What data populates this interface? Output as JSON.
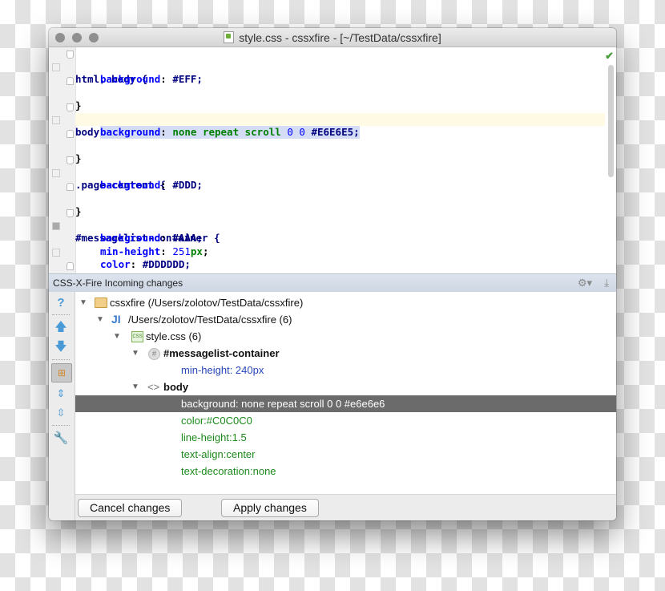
{
  "window": {
    "title": "style.css - cssxfire - [~/TestData/cssxfire]",
    "title_icon": "css-file-icon"
  },
  "editor": {
    "lines": [
      {
        "selector": "html, body {"
      },
      {
        "property": "background",
        "value": "#EFF;"
      },
      {
        "brace": "}"
      },
      {
        "selector": "body {"
      },
      {
        "property": "background",
        "keywords": "none repeat scroll",
        "numbers": "0 0",
        "value": "#E6E6E5;"
      },
      {
        "brace": "}"
      },
      {
        "selector": ".page-content {"
      },
      {
        "property": "background",
        "value": "#DDD;"
      },
      {
        "brace": "}"
      },
      {
        "selector": "#messagelist-container {"
      },
      {
        "property": "background",
        "value": "#AAA;"
      },
      {
        "property": "min-height",
        "number": "251",
        "unit": "px",
        "end": ";"
      },
      {
        "property": "color",
        "value": "#DDDDDD;"
      },
      {
        "brace": "}"
      }
    ],
    "status_icon": "inspection-ok-icon"
  },
  "tool_window": {
    "title": "CSS-X-Fire Incoming changes",
    "actions": [
      "gear-icon",
      "hide-icon"
    ],
    "side_toolbar": [
      "help-icon",
      "previous-icon",
      "next-icon",
      "group-by-file-icon",
      "expand-all-icon",
      "collapse-all-icon",
      "settings-icon"
    ],
    "tree": [
      {
        "label": "cssxfire (/Users/zolotov/TestData/cssxfire)",
        "icon": "folder-icon"
      },
      {
        "label": "/Users/zolotov/TestData/cssxfire (6)",
        "icon": "module-icon"
      },
      {
        "label": "style.css (6)",
        "icon": "css-file-icon"
      },
      {
        "label": "#messagelist-container",
        "icon": "id-selector-icon"
      },
      {
        "label": "min-height: 240px"
      },
      {
        "label": "body",
        "icon": "tag-icon"
      },
      {
        "label": "background: none repeat scroll 0 0 #e6e6e6",
        "selected": true
      },
      {
        "label": "color:#C0C0C0"
      },
      {
        "label": "line-height:1.5"
      },
      {
        "label": "text-align:center"
      },
      {
        "label": "text-decoration:none"
      }
    ],
    "buttons": {
      "cancel": "Cancel changes",
      "apply": "Apply changes"
    }
  },
  "colors": {
    "selection": "#6b6b6b",
    "added_property": "#1b8a1b",
    "changed_property": "#2747b8",
    "current_line": "#fffae3"
  }
}
